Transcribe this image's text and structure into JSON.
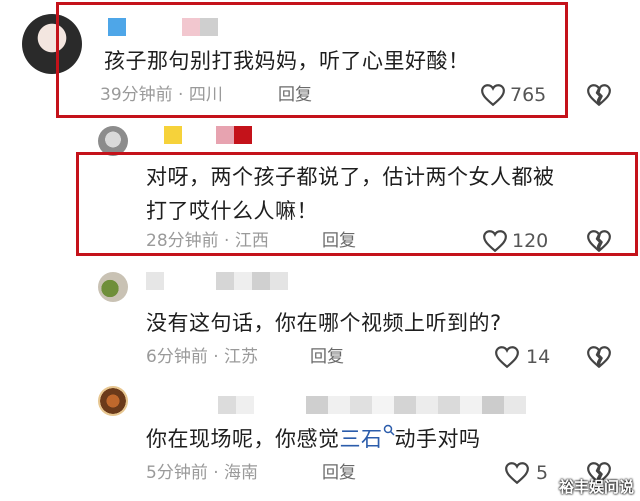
{
  "comments": [
    {
      "text": "孩子那句别打我妈妈，听了心里好酸！",
      "meta": "39分钟前 · 四川",
      "reply": "回复",
      "likes": "765",
      "highlighted": true
    },
    {
      "text_line1": "对呀，两个孩子都说了，估计两个女人都被",
      "text_line2": "打了哎什么人嘛！",
      "meta": "28分钟前 · 江西",
      "reply": "回复",
      "likes": "120",
      "highlighted": true
    },
    {
      "text": "没有这句话，你在哪个视频上听到的?",
      "meta": "6分钟前 · 江苏",
      "reply": "回复",
      "likes": "14",
      "highlighted": false
    },
    {
      "text_before": "你在现场呢，你感觉",
      "text_link": "三石",
      "text_after": "动手对吗",
      "meta": "5分钟前 · 海南",
      "reply": "回复",
      "likes": "5",
      "highlighted": false
    }
  ],
  "watermark": "裕丰娱问说",
  "colors": {
    "highlight_border": "#c4121a",
    "link": "#2b5cab",
    "meta": "#9a9a9a"
  },
  "icons": [
    "heart-icon",
    "broken-heart-icon",
    "search-icon"
  ]
}
